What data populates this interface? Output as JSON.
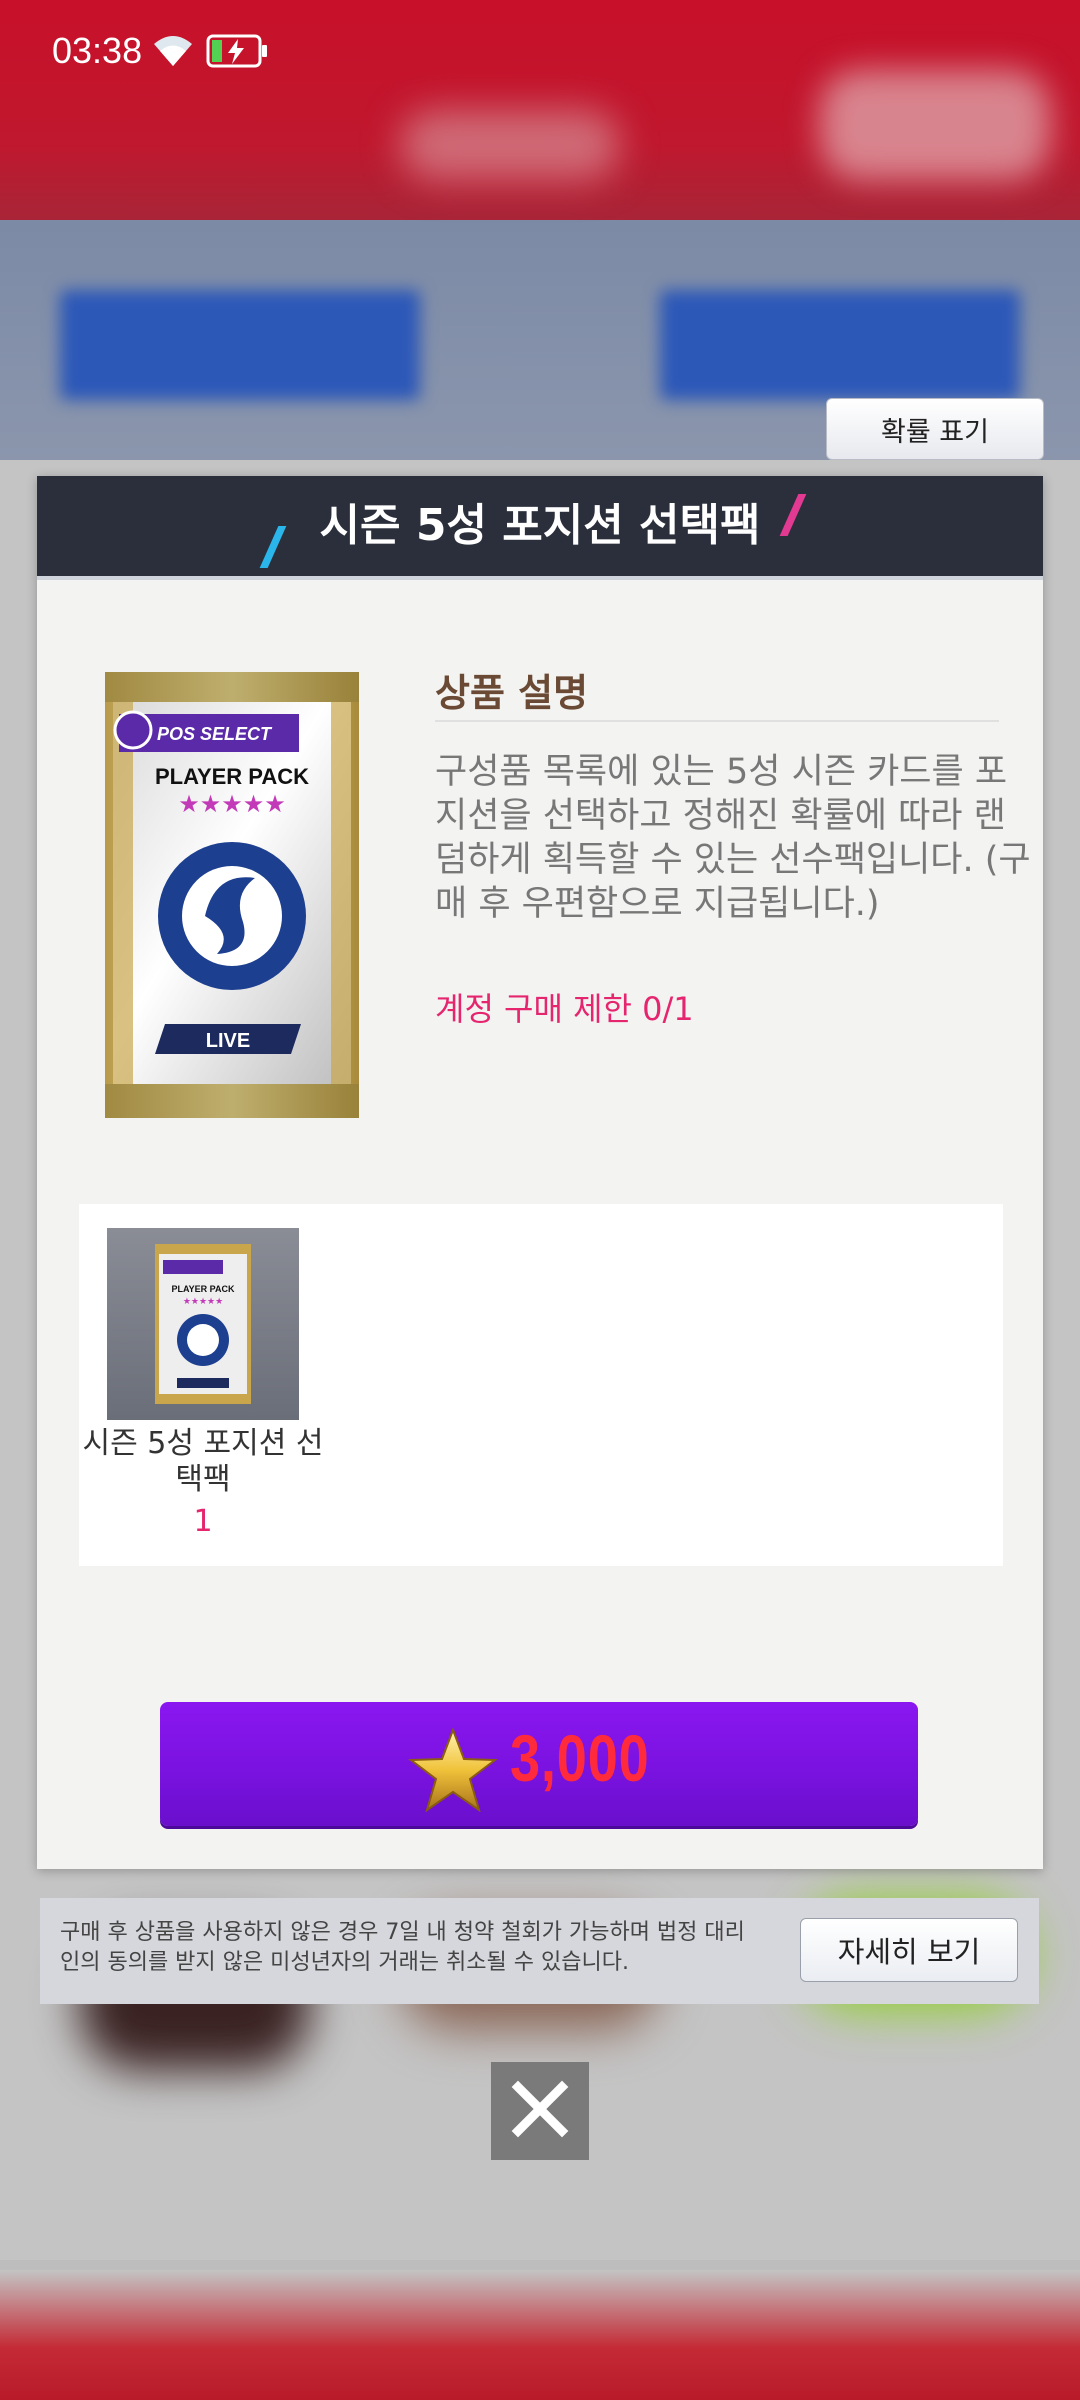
{
  "status_bar": {
    "time": "03:38",
    "wifi_icon": "wifi-icon",
    "battery_icon": "battery-charging-icon"
  },
  "probability_button": {
    "label": "확률 표기"
  },
  "modal": {
    "title": "시즌 5성 포지션 선택팩",
    "pack_art": {
      "brand": "POS SELECT",
      "name": "PLAYER PACK",
      "stars": 5,
      "tag": "LIVE"
    },
    "description": {
      "heading": "상품 설명",
      "body": "구성품 목록에 있는 5성 시즌 카드를 포지션을 선택하고 정해진 확률에 따라 랜덤하게 획득할 수 있는 선수팩입니다. (구매 후 우편함으로 지급됩니다.)",
      "purchase_limit": "계정 구매 제한 0/1"
    },
    "contents": [
      {
        "name": "시즌 5성 포지션 선택팩",
        "quantity": "1"
      }
    ],
    "buy_button": {
      "price": "3,000",
      "currency_icon": "gold-star-icon"
    }
  },
  "notice": {
    "text": "구매 후 상품을 사용하지 않은 경우 7일 내 청약 철회가 가능하며 법정 대리인의 동의를 받지 않은 미성년자의 거래는 취소될 수 있습니다.",
    "detail_button": "자세히 보기"
  },
  "close_button": {
    "icon": "close-icon"
  },
  "colors": {
    "accent_pink": "#e5266f",
    "buy_purple": "#7a12e0",
    "price_red": "#ff2a3c",
    "header_navy": "#2a2f3b"
  }
}
